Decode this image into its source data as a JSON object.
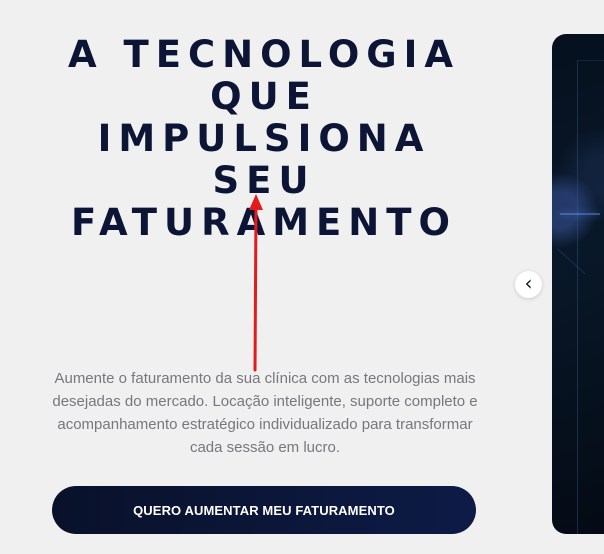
{
  "hero": {
    "title_lines": [
      "A TECNOLOGIA",
      "QUE IMPULSIONA",
      "SEU",
      "FATURAMENTO"
    ],
    "description": "Aumente o faturamento da sua clínica com as tecnologias mais desejadas do mercado. Locação inteligente, suporte completo e acompanhamento estratégico individualizado para transformar cada sessão em lucro.",
    "cta_label": "QUERO AUMENTAR MEU FATURAMENTO"
  },
  "carousel": {
    "previous_glyph": "‹",
    "previous_icon": "chevron-left-icon"
  },
  "annotation": {
    "arrow_icon": "red-arrow-icon",
    "arrow_color": "#e31b1b"
  },
  "colors": {
    "background": "#f0f0f0",
    "title": "#0c1535",
    "body_text": "#77777d",
    "button": "#0d1b46",
    "button_text": "#ffffff",
    "carousel_card": "#07111f"
  }
}
